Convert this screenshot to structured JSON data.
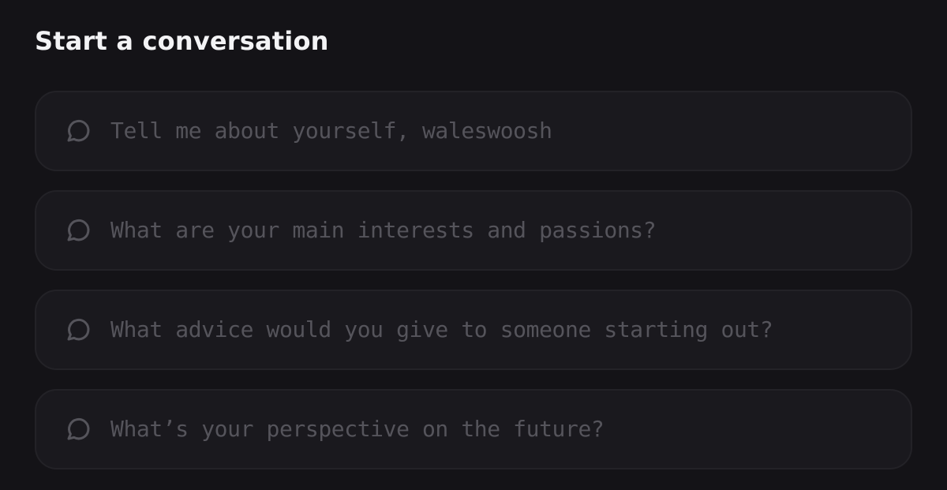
{
  "section": {
    "title": "Start a conversation"
  },
  "prompts": [
    {
      "icon": "chat-bubble-icon",
      "label": "Tell me about yourself, waleswoosh"
    },
    {
      "icon": "chat-bubble-icon",
      "label": "What are your main interests and passions?"
    },
    {
      "icon": "chat-bubble-icon",
      "label": "What advice would you give to someone starting out?"
    },
    {
      "icon": "chat-bubble-icon",
      "label": "What’s your perspective on the future?"
    }
  ],
  "colors": {
    "background": "#141317",
    "card_background": "#1a191e",
    "card_border": "#232227",
    "title_text": "#f3f3f5",
    "prompt_text": "#55545b"
  }
}
